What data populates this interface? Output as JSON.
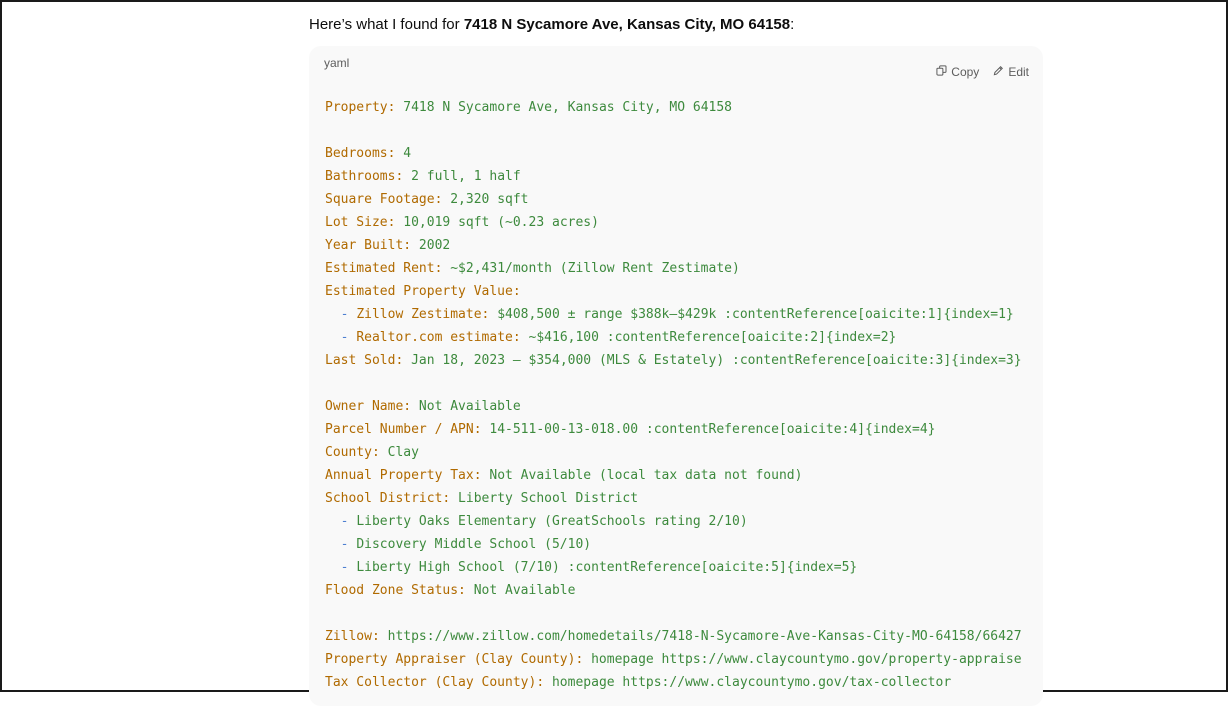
{
  "intro": {
    "prefix": "Here’s what I found for ",
    "address": "7418 N Sycamore Ave, Kansas City, MO 64158",
    "suffix": ":"
  },
  "codeblock": {
    "language": "yaml",
    "copy_label": "Copy",
    "edit_label": "Edit",
    "lines": [
      {
        "key": "Property:",
        "value": " 7418 N Sycamore Ave, Kansas City, MO 64158"
      },
      {
        "blank": true
      },
      {
        "key": "Bedrooms:",
        "value": " 4"
      },
      {
        "key": "Bathrooms:",
        "value": " 2 full, 1 half"
      },
      {
        "key": "Square Footage:",
        "value": " 2,320 sqft"
      },
      {
        "key": "Lot Size:",
        "value": " 10,019 sqft (~0.23 acres)"
      },
      {
        "key": "Year Built:",
        "value": " 2002"
      },
      {
        "key": "Estimated Rent:",
        "value": " ~$2,431/month (Zillow Rent Zestimate)"
      },
      {
        "key": "Estimated Property Value:",
        "value": ""
      },
      {
        "dash": "  - ",
        "key": "Zillow Zestimate:",
        "value": " $408,500 ± range $388k–$429k :contentReference[oaicite:1]{index=1}"
      },
      {
        "dash": "  - ",
        "key": "Realtor.com estimate:",
        "value": " ~$416,100 :contentReference[oaicite:2]{index=2}"
      },
      {
        "key": "Last Sold:",
        "value": " Jan 18, 2023 – $354,000 (MLS & Estately) :contentReference[oaicite:3]{index=3}"
      },
      {
        "blank": true
      },
      {
        "key": "Owner Name:",
        "value": " Not Available"
      },
      {
        "key": "Parcel Number / APN:",
        "value": " 14-511-00-13-018.00 :contentReference[oaicite:4]{index=4}"
      },
      {
        "key": "County:",
        "value": " Clay"
      },
      {
        "key": "Annual Property Tax:",
        "value": " Not Available (local tax data not found)"
      },
      {
        "key": "School District:",
        "value": " Liberty School District"
      },
      {
        "dash": "  - ",
        "key": "",
        "value": "Liberty Oaks Elementary (GreatSchools rating 2/10)"
      },
      {
        "dash": "  - ",
        "key": "",
        "value": "Discovery Middle School (5/10)"
      },
      {
        "dash": "  - ",
        "key": "",
        "value": "Liberty High School (7/10) :contentReference[oaicite:5]{index=5}"
      },
      {
        "key": "Flood Zone Status:",
        "value": " Not Available"
      },
      {
        "blank": true
      },
      {
        "key": "Zillow:",
        "value": " https://www.zillow.com/homedetails/7418-N-Sycamore-Ave-Kansas-City-MO-64158/66427"
      },
      {
        "key": "Property Appraiser (Clay County):",
        "value": " homepage https://www.claycountymo.gov/property-appraise"
      },
      {
        "key": "Tax Collector (Clay County):",
        "value": " homepage https://www.claycountymo.gov/tax-collector"
      }
    ]
  }
}
